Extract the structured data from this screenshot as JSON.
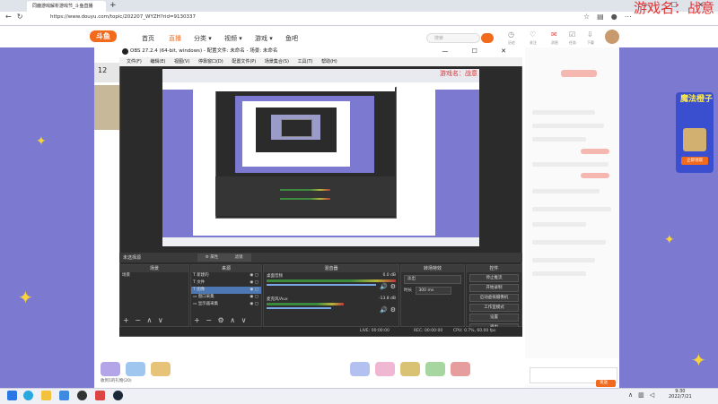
{
  "browser": {
    "tab_title": "同鹿游戏解析游戏节_斗鱼直播",
    "new_tab": "+",
    "win_controls": "— ☐ ✕",
    "url": "https://www.douyu.com/topic/202207_WYZH?rid=9130337",
    "watermark": "游戏名：战意"
  },
  "site": {
    "logo": "斗鱼",
    "nav": [
      "首页",
      "直播",
      "分类 ▾",
      "视频 ▾",
      "游戏 ▾",
      "鱼吧"
    ],
    "search_placeholder": "搜索",
    "header_icons": [
      {
        "icon": "history-icon",
        "label": "历史"
      },
      {
        "icon": "follow-icon",
        "label": "关注"
      },
      {
        "icon": "message-icon",
        "label": "消息"
      },
      {
        "icon": "task-icon",
        "label": "任务"
      },
      {
        "icon": "download-icon",
        "label": "下载"
      }
    ],
    "room_badge": "12",
    "gift_label": "收到1的礼物(20)",
    "send_label": "发送",
    "ad_title": "魔法橙子",
    "ad_button": "立即领取"
  },
  "obs": {
    "title": "OBS 27.2.4 (64-bit, windows) - 配置文件: 未命名 - 场景: 未命名",
    "window_controls": "— ☐ ✕",
    "menu": [
      "文件(F)",
      "编辑(E)",
      "视图(V)",
      "停靠窗口(D)",
      "配置文件(P)",
      "场景集合(S)",
      "工具(T)",
      "帮助(H)"
    ],
    "preview_watermark": "游戏名：战意",
    "no_source": "未选择源",
    "properties_btn": "⚙ 属性",
    "filters_btn": "滤镜",
    "docks": {
      "scenes": {
        "title": "场景",
        "items": [
          "场景"
        ]
      },
      "sources": {
        "title": "来源",
        "items": [
          {
            "name": "新建的",
            "selected": false
          },
          {
            "name": "文件",
            "selected": false
          },
          {
            "name": "图像",
            "selected": true
          },
          {
            "name": "窗口采集",
            "selected": false
          },
          {
            "name": "显示器采集",
            "selected": false
          }
        ]
      },
      "mixer": {
        "title": "混音器",
        "tracks": [
          {
            "name": "桌面音频",
            "db": "0.0 dB"
          },
          {
            "name": "麦克风/Aux",
            "db": "-13.8 dB"
          }
        ]
      },
      "transitions": {
        "title": "转场特效",
        "type": "淡出",
        "duration_label": "时长",
        "duration": "300 ms"
      },
      "controls": {
        "title": "控件",
        "buttons": [
          "停止推流",
          "开始录制",
          "启动虚拟摄像机",
          "工作室模式",
          "设置",
          "退出"
        ]
      }
    },
    "dock_footer": "+ − ∧ ∨",
    "status": {
      "live": "LIVE: 00:00:00",
      "rec": "REC: 00:00:00",
      "cpu": "CPU: 0.7%, 60.00 fps"
    }
  },
  "taskbar": {
    "clock_time": "9:30",
    "clock_date": "2022/7/21"
  }
}
